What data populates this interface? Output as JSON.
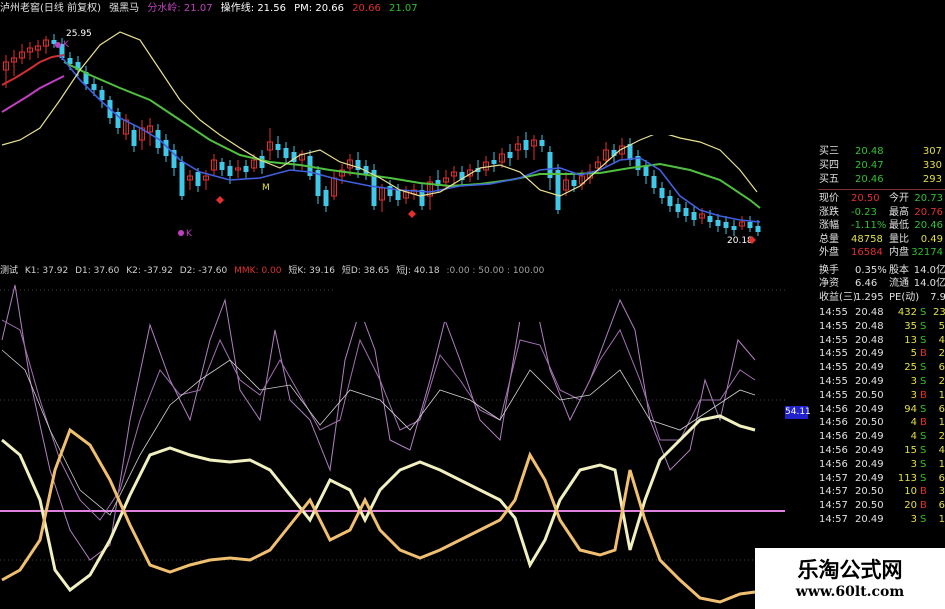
{
  "header": {
    "stock": "泸州老窖(日线 前复权)",
    "indicator": "强黑马",
    "fenshui_label": "分水岭:",
    "fenshui_value": "21.07",
    "caozuo_label": "操作线:",
    "caozuo_value": "21.56",
    "pm_label": "PM:",
    "pm_value": "20.66",
    "v4": "20.66",
    "v5": "21.07",
    "colors": {
      "title": "#e0e0e0",
      "fenshui": "#c040c0",
      "caozuo": "#ffffff",
      "pm": "#ffffff",
      "v4": "#e03030",
      "v5": "#30c030"
    }
  },
  "chart_annotations": {
    "high_label": "25.95",
    "low_label": "20.18",
    "k_label_1": "K",
    "k_label_2": "K",
    "m_label": "M"
  },
  "price_scale": [
    "22.50",
    "22.00",
    "21.50",
    "21.00",
    "20.50",
    "20.00"
  ],
  "indicator_header": {
    "name": "测试",
    "items": [
      {
        "label": "K1: 37.92",
        "color": "#d0d0d0"
      },
      {
        "label": "D1: 37.60",
        "color": "#d0d0d0"
      },
      {
        "label": "K2: -37.92",
        "color": "#d0d0d0"
      },
      {
        "label": "D2: -37.60",
        "color": "#d0d0d0"
      },
      {
        "label": "MMK: 0.00",
        "color": "#e03030"
      },
      {
        "label": "短K: 39.16",
        "color": "#d0d0d0"
      },
      {
        "label": "短D: 38.65",
        "color": "#d0d0d0"
      },
      {
        "label": "短J: 40.18",
        "color": "#d0d0d0"
      },
      {
        "label": ":0.00 : 50.00 : 100.00",
        "color": "#a0a0a0"
      }
    ]
  },
  "indicator_scale": [
    "100.00",
    "80.00",
    "60.00",
    "40.00",
    "20.00",
    "0.00",
    "-20.00",
    "-40.00",
    "-60.00",
    "-80.00",
    "-100.00"
  ],
  "value_tag": "54.11",
  "order_book": [
    {
      "label": "买三",
      "price": "20.48",
      "vol": "307"
    },
    {
      "label": "买四",
      "price": "20.47",
      "vol": "330"
    },
    {
      "label": "买五",
      "price": "20.46",
      "vol": "293"
    }
  ],
  "quote_stats": [
    {
      "l1": "现价",
      "v1": "20.50",
      "l2": "今开",
      "v2": "20.73",
      "c1": "#e03030",
      "c2": "#30c030"
    },
    {
      "l1": "涨跌",
      "v1": "-0.23",
      "l2": "最高",
      "v2": "20.76",
      "c1": "#30c030",
      "c2": "#e03030"
    },
    {
      "l1": "涨幅",
      "v1": "-1.11%",
      "l2": "最低",
      "v2": "20.46",
      "c1": "#30c030",
      "c2": "#30c030"
    },
    {
      "l1": "总量",
      "v1": "48758",
      "l2": "量比",
      "v2": "0.49",
      "c1": "#e0e040",
      "c2": "#e0e040"
    },
    {
      "l1": "外盘",
      "v1": "16584",
      "l2": "内盘",
      "v2": "32174",
      "c1": "#e03030",
      "c2": "#30c030"
    }
  ],
  "quote_stats2": [
    {
      "l1": "换手",
      "v1": "0.35%",
      "l2": "股本",
      "v2": "14.0亿",
      "c1": "#e0e0e0",
      "c2": "#e0e0e0"
    },
    {
      "l1": "净资",
      "v1": "6.46",
      "l2": "流通",
      "v2": "14.0亿",
      "c1": "#e0e0e0",
      "c2": "#e0e0e0"
    },
    {
      "l1": "收益(三)",
      "v1": "1.295",
      "l2": "PE(动)",
      "v2": "7.9",
      "c1": "#e0e0e0",
      "c2": "#e0e0e0"
    }
  ],
  "ticks": [
    {
      "time": "14:55",
      "price": "20.48",
      "vol": "432",
      "side": "S",
      "n": "23"
    },
    {
      "time": "14:55",
      "price": "20.48",
      "vol": "35",
      "side": "S",
      "n": "5"
    },
    {
      "time": "14:55",
      "price": "20.48",
      "vol": "13",
      "side": "S",
      "n": "4"
    },
    {
      "time": "14:55",
      "price": "20.49",
      "vol": "5",
      "side": "B",
      "n": "2"
    },
    {
      "time": "14:55",
      "price": "20.49",
      "vol": "25",
      "side": "S",
      "n": "6"
    },
    {
      "time": "14:55",
      "price": "20.49",
      "vol": "3",
      "side": "S",
      "n": "2"
    },
    {
      "time": "14:55",
      "price": "20.50",
      "vol": "3",
      "side": "B",
      "n": "1"
    },
    {
      "time": "14:56",
      "price": "20.49",
      "vol": "94",
      "side": "S",
      "n": "6"
    },
    {
      "time": "14:56",
      "price": "20.50",
      "vol": "4",
      "side": "B",
      "n": "1"
    },
    {
      "time": "14:56",
      "price": "20.49",
      "vol": "4",
      "side": "S",
      "n": "2"
    },
    {
      "time": "14:56",
      "price": "20.49",
      "vol": "15",
      "side": "S",
      "n": "4"
    },
    {
      "time": "14:56",
      "price": "20.49",
      "vol": "3",
      "side": "S",
      "n": "1"
    },
    {
      "time": "14:57",
      "price": "20.49",
      "vol": "113",
      "side": "S",
      "n": "6"
    },
    {
      "time": "14:57",
      "price": "20.50",
      "vol": "10",
      "side": "B",
      "n": "3"
    },
    {
      "time": "14:57",
      "price": "20.50",
      "vol": "20",
      "side": "B",
      "n": "6"
    },
    {
      "time": "14:57",
      "price": "20.49",
      "vol": "3",
      "side": "S",
      "n": "1"
    }
  ],
  "watermark": {
    "title": "乐淘公式网",
    "url": "www.60lt.com"
  }
}
